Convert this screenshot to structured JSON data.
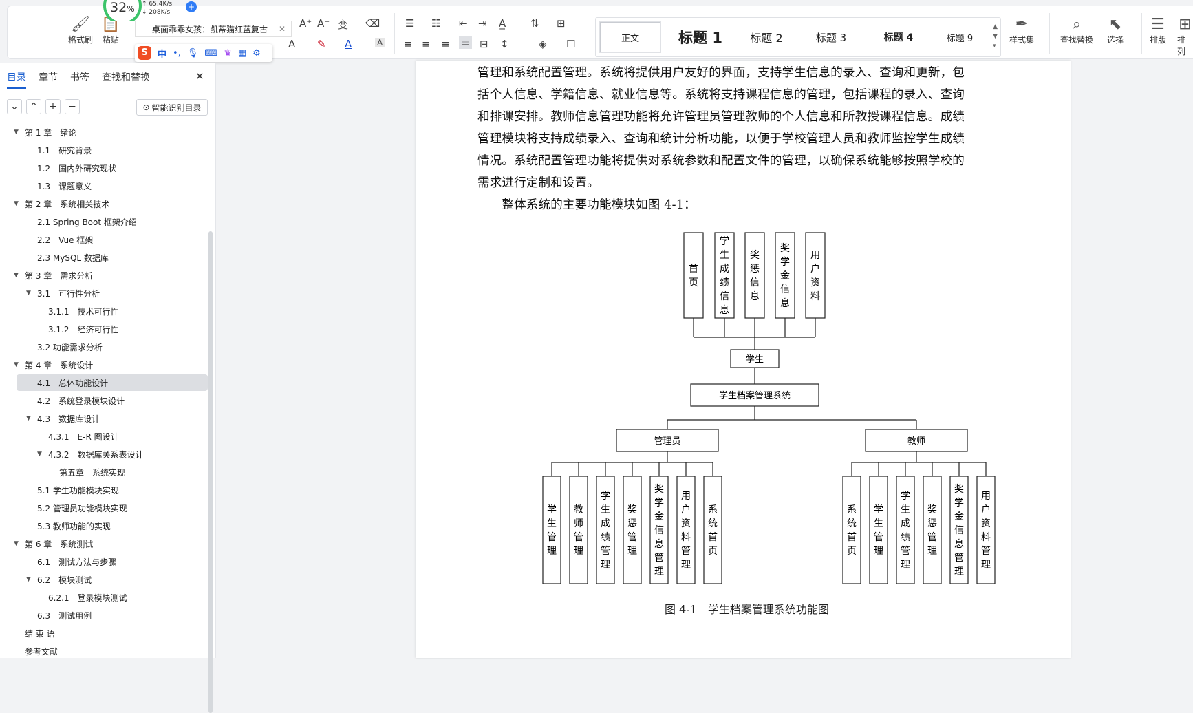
{
  "ribbon": {
    "format_painter": "格式刷",
    "paste": "粘贴",
    "style_normal": "正文",
    "style_h1": "标题 1",
    "style_h2": "标题 2",
    "style_h3": "标题 3",
    "style_h4": "标题 4",
    "style_h9": "标题 9",
    "style_set": "样式集",
    "find_replace": "查找替换",
    "select": "选择",
    "layout": "排版",
    "arrange": "排列"
  },
  "widget": {
    "percent": "32",
    "percent_sign": "%",
    "up_speed": "65.4K/s",
    "down_speed": "208K/s"
  },
  "notification": "桌面乖乖女孩：凯蒂猫红蓝复古",
  "ime": {
    "mode": "中"
  },
  "sidebar": {
    "tabs": [
      "目录",
      "章节",
      "书签",
      "查找和替换"
    ],
    "smart_toc": "智能识别目录",
    "toc": [
      {
        "label": "第 1 章　绪论",
        "level": 0,
        "arrow": true
      },
      {
        "label": "1.1　研究背景",
        "level": 1
      },
      {
        "label": "1.2　国内外研究现状",
        "level": 1
      },
      {
        "label": "1.3　课题意义",
        "level": 1
      },
      {
        "label": "第 2 章　系统相关技术",
        "level": 0,
        "arrow": true
      },
      {
        "label": "2.1 Spring Boot 框架介绍",
        "level": 1
      },
      {
        "label": "2.2　Vue 框架",
        "level": 1
      },
      {
        "label": "2.3 MySQL 数据库",
        "level": 1
      },
      {
        "label": "第 3 章　需求分析",
        "level": 0,
        "arrow": true
      },
      {
        "label": "3.1　可行性分析",
        "level": 1,
        "arrow": true
      },
      {
        "label": "3.1.1　技术可行性",
        "level": 2
      },
      {
        "label": "3.1.2　经济可行性",
        "level": 2
      },
      {
        "label": "3.2 功能需求分析",
        "level": 1
      },
      {
        "label": "第 4 章　系统设计",
        "level": 0,
        "arrow": true
      },
      {
        "label": "4.1　总体功能设计",
        "level": 1,
        "selected": true
      },
      {
        "label": "4.2　系统登录模块设计",
        "level": 1
      },
      {
        "label": "4.3　数据库设计",
        "level": 1,
        "arrow": true
      },
      {
        "label": "4.3.1　E-R 图设计",
        "level": 2
      },
      {
        "label": "4.3.2　数据库关系表设计",
        "level": 2,
        "arrow": true
      },
      {
        "label": "第五章　系统实现",
        "level": 3
      },
      {
        "label": "5.1 学生功能模块实现",
        "level": 1
      },
      {
        "label": "5.2 管理员功能模块实现",
        "level": 1
      },
      {
        "label": "5.3 教师功能的实现",
        "level": 1
      },
      {
        "label": "第 6 章　系统测试",
        "level": 0,
        "arrow": true
      },
      {
        "label": "6.1　测试方法与步骤",
        "level": 1
      },
      {
        "label": "6.2　模块测试",
        "level": 1,
        "arrow": true
      },
      {
        "label": "6.2.1　登录模块测试",
        "level": 2
      },
      {
        "label": "6.3　测试用例",
        "level": 1
      },
      {
        "label": "结 束 语",
        "level": 0
      },
      {
        "label": "参考文献",
        "level": 0
      }
    ]
  },
  "document": {
    "lines": [
      "管理和系统配置管理。系统将提供用户友好的界面，支持学生信息的录入、查询和更新，包",
      "括个人信息、学籍信息、就业信息等。系统将支持课程信息的管理，包括课程的录入、查询",
      "和排课安排。教师信息管理功能将允许管理员管理教师的个人信息和所教授课程信息。成绩",
      "管理模块将支持成绩录入、查询和统计分析功能，以便于学校管理人员和教师监控学生成绩",
      "情况。系统配置管理功能将提供对系统参数和配置文件的管理，以确保系统能够按照学校的",
      "需求进行定制和设置。",
      "　　整体系统的主要功能模块如图 4-1："
    ],
    "caption": "图 4-1　学生档案管理系统功能图",
    "diagram": {
      "root": "学生档案管理系统",
      "student": "学生",
      "student_modules": [
        "首页",
        "学生成绩信息",
        "奖惩信息",
        "奖学金信息",
        "用户资料"
      ],
      "admin": "管理员",
      "admin_modules": [
        "学生管理",
        "教师管理",
        "学生成绩管理",
        "奖惩管理",
        "奖学金信息管理",
        "用户资料管理",
        "系统首页"
      ],
      "teacher": "教师",
      "teacher_modules": [
        "系统首页",
        "学生管理",
        "学生成绩管理",
        "奖惩管理",
        "奖学金信息管理",
        "用户资料管理"
      ]
    }
  }
}
